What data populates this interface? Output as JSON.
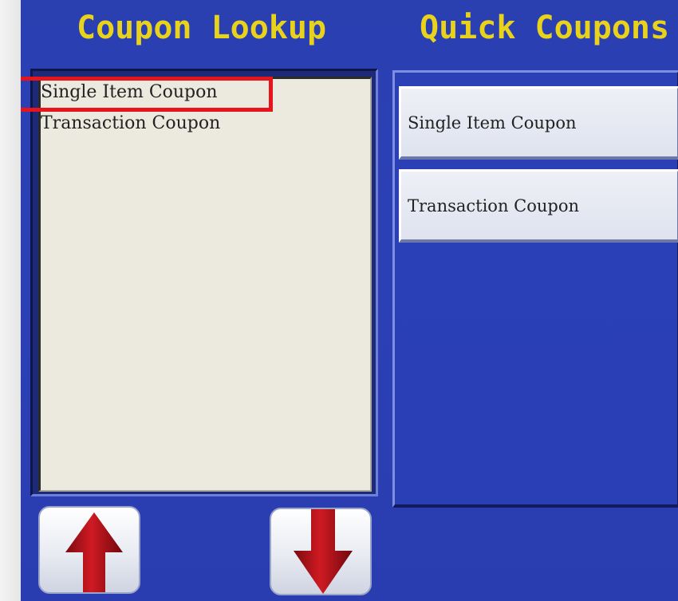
{
  "header": {
    "left_title": "Coupon Lookup",
    "right_title": "Quick Coupons"
  },
  "coupon_list": {
    "items": [
      {
        "label": "Single Item Coupon",
        "highlighted": true
      },
      {
        "label": "Transaction Coupon",
        "highlighted": false
      }
    ]
  },
  "quick_coupons": {
    "buttons": [
      {
        "label": "Single Item Coupon"
      },
      {
        "label": "Transaction Coupon"
      }
    ]
  },
  "scroll_buttons": {
    "up_icon": "up-arrow-icon",
    "down_icon": "down-arrow-icon"
  },
  "colors": {
    "background": "#2a3fb0",
    "title": "#e8d21c",
    "list_background": "#eceadf",
    "highlight_border": "#e8141b",
    "arrow": "#b0121a"
  }
}
